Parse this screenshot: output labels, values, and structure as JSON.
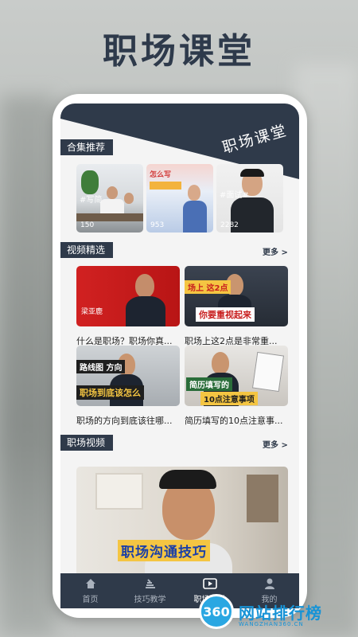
{
  "promo": {
    "title": "职场课堂"
  },
  "hero": {
    "title": "职场课堂"
  },
  "sections": {
    "collections": {
      "label": "合集推荐",
      "items": [
        {
          "tag": "#写简",
          "views": "150"
        },
        {
          "tag": "怎么写",
          "views": "953"
        },
        {
          "tag": "#面试#",
          "views": "2282"
        }
      ]
    },
    "featured": {
      "label": "视频精选",
      "more": "更多 >",
      "items": [
        {
          "overlay": "梁亚鹿",
          "caption": "什么是职场？职场你真..."
        },
        {
          "overlay_top": "场上 这2点",
          "overlay_bottom": "你要重视起来",
          "caption": "职场上这2点是非常重..."
        },
        {
          "overlay_top": "路线图  方向",
          "overlay_bottom": "职场到底该怎么",
          "caption": "职场的方向到底该往哪..."
        },
        {
          "overlay_top": "简历填写的",
          "overlay_bottom": "10点注意事项",
          "caption": "简历填写的10点注意事..."
        }
      ]
    },
    "videos": {
      "label": "职场视频",
      "more": "更多 >",
      "banner_text": "职场沟通技巧"
    }
  },
  "tabbar": {
    "items": [
      {
        "label": "首页",
        "icon": "home-icon",
        "active": false
      },
      {
        "label": "技巧教学",
        "icon": "skills-icon",
        "active": false
      },
      {
        "label": "职场课堂",
        "icon": "video-icon",
        "active": true
      },
      {
        "label": "我的",
        "icon": "user-icon",
        "active": false
      }
    ]
  },
  "watermark": {
    "badge": "360",
    "name": "网站排行榜",
    "sub": "WANGZHAN360.CN"
  },
  "colors": {
    "navy": "#2f3a4a",
    "accent_red": "#c81e1e",
    "brand_blue": "#1793d6"
  }
}
